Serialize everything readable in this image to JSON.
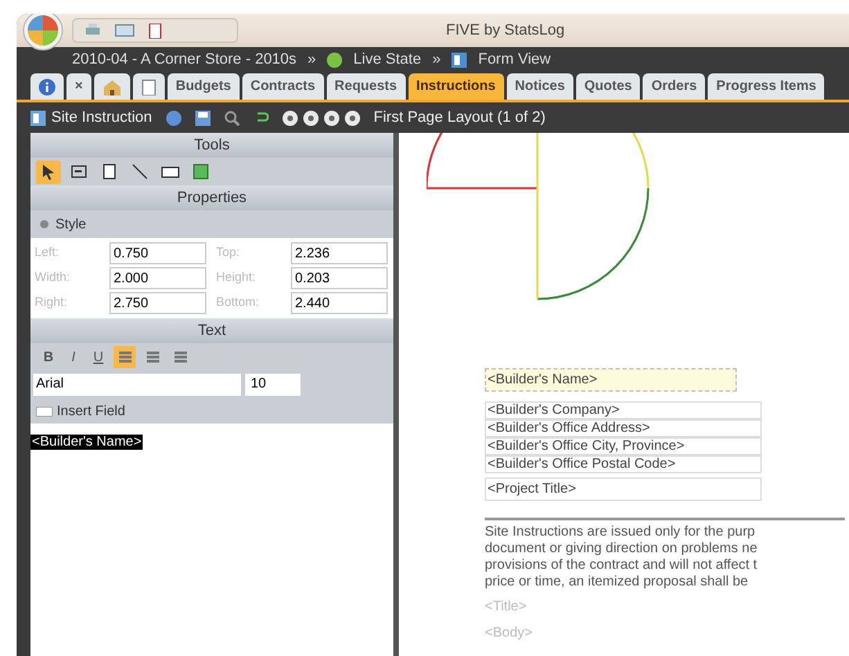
{
  "window": {
    "title": "FIVE by StatsLog"
  },
  "breadcrumb": {
    "project": "2010-04 - A Corner Store - 2010s",
    "separator": "»",
    "state": "Live State",
    "view": "Form View"
  },
  "tabs": [
    {
      "kind": "info",
      "selected": false
    },
    {
      "kind": "text",
      "label": "×",
      "selected": false
    },
    {
      "kind": "home",
      "selected": false
    },
    {
      "kind": "doc",
      "selected": false
    },
    {
      "kind": "text",
      "label": "Budgets",
      "selected": false
    },
    {
      "kind": "text",
      "label": "Contracts",
      "selected": false
    },
    {
      "kind": "text",
      "label": "Requests",
      "selected": false
    },
    {
      "kind": "text",
      "label": "Instructions",
      "selected": true
    },
    {
      "kind": "text",
      "label": "Notices",
      "selected": false
    },
    {
      "kind": "text",
      "label": "Quotes",
      "selected": false
    },
    {
      "kind": "text",
      "label": "Orders",
      "selected": false
    },
    {
      "kind": "text",
      "label": "Progress Items",
      "selected": false
    }
  ],
  "toolbar": {
    "document": "Site Instruction",
    "page": "First Page Layout (1 of 2)"
  },
  "tools": {
    "title": "Tools",
    "items": [
      {
        "kind": "pointer",
        "selected": true
      },
      {
        "kind": "field",
        "selected": false
      },
      {
        "kind": "page",
        "selected": false
      },
      {
        "kind": "line",
        "selected": false
      },
      {
        "kind": "rect",
        "selected": false
      },
      {
        "kind": "image",
        "selected": false
      }
    ]
  },
  "properties": {
    "title": "Properties",
    "style_label": "Style",
    "fields": [
      {
        "label": "Left:",
        "value": "0.750"
      },
      {
        "label": "Top:",
        "value": "2.236"
      },
      {
        "label": "Width:",
        "value": "2.000"
      },
      {
        "label": "Height:",
        "value": "0.203"
      },
      {
        "label": "Right:",
        "value": "2.750"
      },
      {
        "label": "Bottom:",
        "value": "2.440"
      }
    ]
  },
  "text_panel": {
    "title": "Text",
    "format": [
      {
        "label": "B",
        "selected": false
      },
      {
        "label": "I",
        "selected": false
      },
      {
        "label": "U",
        "selected": false
      }
    ],
    "align": [
      {
        "selected": true
      },
      {
        "selected": false
      },
      {
        "selected": false
      }
    ],
    "font": "Arial",
    "size": "10",
    "insert_field": "Insert Field",
    "content": "<Builder's Name>"
  },
  "canvas": {
    "name_field": "<Builder's Name>",
    "address": [
      "<Builder's Company>",
      "<Builder's Office Address>",
      "<Builder's Office City, Province>",
      "<Builder's Office Postal Code>"
    ],
    "project": "<Project Title>",
    "paragraph": [
      "Site Instructions are issued only for the purp",
      "document or giving direction on problems ne",
      "provisions of the contract and will not affect t",
      "price or time, an itemized proposal shall be"
    ],
    "footer": [
      "<Title>",
      "<Body>"
    ]
  }
}
